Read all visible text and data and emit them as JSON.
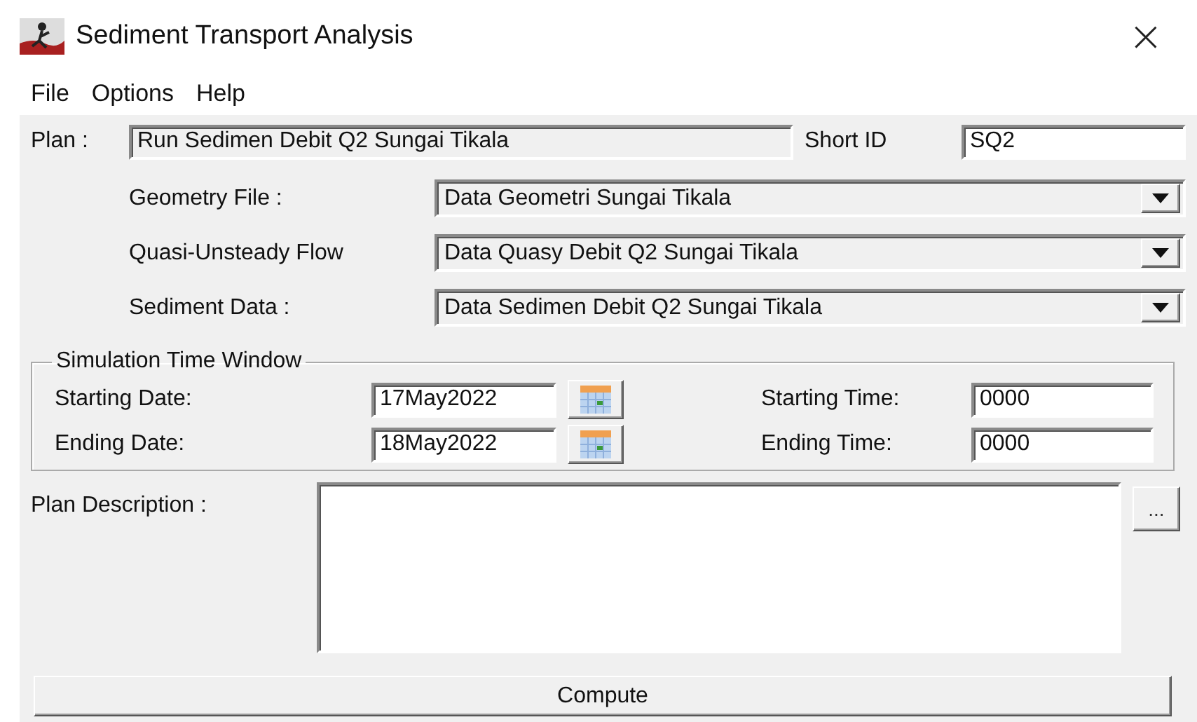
{
  "window": {
    "title": "Sediment Transport Analysis",
    "close": "×"
  },
  "menu": [
    "File",
    "Options",
    "Help"
  ],
  "plan": {
    "label": "Plan :",
    "value": "Run Sedimen Debit Q2 Sungai Tikala",
    "short_id_label": "Short ID",
    "short_id": "SQ2"
  },
  "selectors": [
    {
      "label": "Geometry File :",
      "value": "Data Geometri Sungai Tikala"
    },
    {
      "label": "Quasi-Unsteady Flow",
      "value": "Data Quasy Debit Q2 Sungai Tikala"
    },
    {
      "label": "Sediment Data :",
      "value": "Data Sedimen Debit Q2 Sungai Tikala"
    }
  ],
  "simulation_time_window": {
    "title": "Simulation Time Window",
    "rows": [
      {
        "date_label": "Starting Date:",
        "date": "17May2022",
        "time_label": "Starting Time:",
        "time": "0000"
      },
      {
        "date_label": "Ending Date:",
        "date": "18May2022",
        "time_label": "Ending Time:",
        "time": "0000"
      }
    ]
  },
  "plan_description": {
    "label": "Plan Description :",
    "button": "..."
  },
  "compute_button": "Compute"
}
